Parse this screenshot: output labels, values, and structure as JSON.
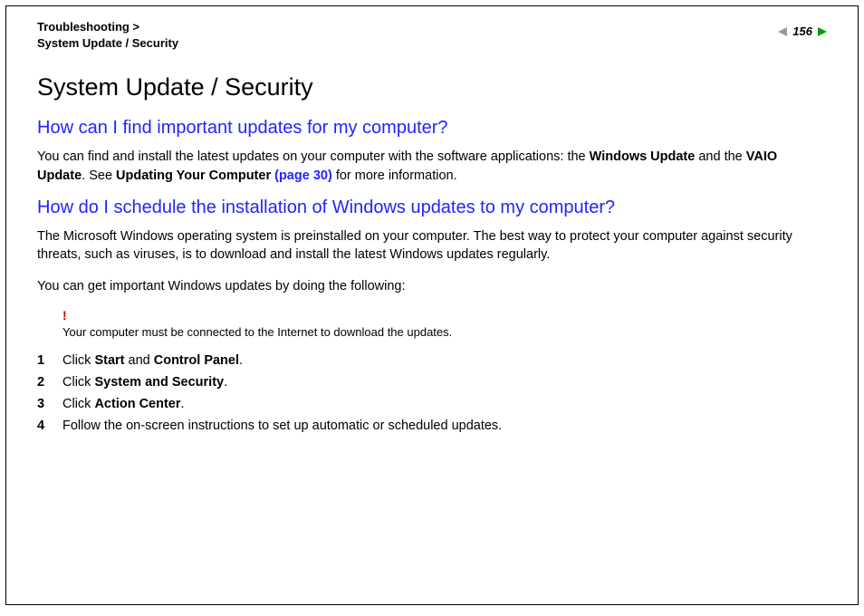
{
  "breadcrumb": {
    "line1": "Troubleshooting >",
    "line2": "System Update / Security"
  },
  "pageNumber": "156",
  "title": "System Update / Security",
  "section1": {
    "heading": "How can I find important updates for my computer?",
    "para": {
      "pre1": "You can find and install the latest updates on your computer with the software applications: the ",
      "b1": "Windows Update",
      "mid1": " and the ",
      "b2": "VAIO Update",
      "mid2": ". See ",
      "b3": "Updating Your Computer ",
      "link": "(page 30)",
      "post": " for more information."
    }
  },
  "section2": {
    "heading": "How do I schedule the installation of Windows updates to my computer?",
    "para1": "The Microsoft Windows operating system is preinstalled on your computer. The best way to protect your computer against security threats, such as viruses, is to download and install the latest Windows updates regularly.",
    "para2": "You can get important Windows updates by doing the following:",
    "noteIcon": "!",
    "noteText": "Your computer must be connected to the Internet to download the updates.",
    "steps": [
      {
        "num": "1",
        "pre": "Click ",
        "b1": "Start",
        "mid": " and ",
        "b2": "Control Panel",
        "post": "."
      },
      {
        "num": "2",
        "pre": "Click ",
        "b1": "System and Security",
        "mid": "",
        "b2": "",
        "post": "."
      },
      {
        "num": "3",
        "pre": "Click ",
        "b1": "Action Center",
        "mid": "",
        "b2": "",
        "post": "."
      },
      {
        "num": "4",
        "pre": "Follow the on-screen instructions to set up automatic or scheduled updates.",
        "b1": "",
        "mid": "",
        "b2": "",
        "post": ""
      }
    ]
  }
}
